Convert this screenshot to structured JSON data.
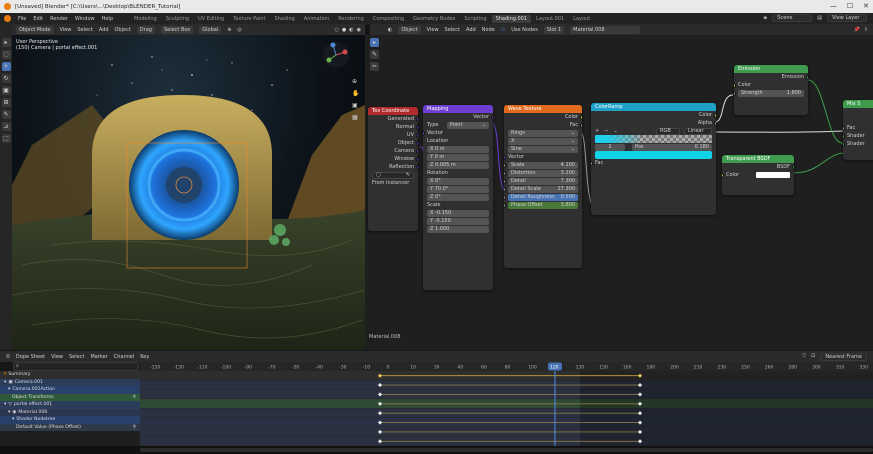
{
  "window": {
    "title": "[Unsaved] Blender* [C:\\Users\\...\\Desktop\\BLENDER_Tutorial]",
    "controls": [
      "—",
      "☐",
      "✕"
    ]
  },
  "menubar": {
    "items": [
      "File",
      "Edit",
      "Render",
      "Window",
      "Help"
    ],
    "workspaces": [
      "Modeling",
      "Sculpting",
      "UV Editing",
      "Texture Paint",
      "Shading",
      "Animation",
      "Rendering",
      "Compositing",
      "Geometry Nodes",
      "Scripting",
      "Shading.001",
      "Layout.001",
      "Layout"
    ],
    "active_workspace": "Shading.001",
    "scene": "Scene",
    "view_layer": "View Layer"
  },
  "viewport": {
    "header": {
      "mode": "Object Mode",
      "items": [
        "View",
        "Select",
        "Add",
        "Object"
      ],
      "drag": "Drag",
      "select": "Select Box",
      "transform": "Global"
    },
    "info_line1": "User Perspective",
    "info_line2": "(150) Camera | portal effect.001",
    "bottom_label": "Material.008",
    "tools": [
      "cursor-tool",
      "select-tool",
      "move-tool",
      "rotate-tool",
      "scale-tool",
      "transform-tool",
      "annotate-tool",
      "measure-tool",
      "add-cube-tool"
    ]
  },
  "node_editor": {
    "header": {
      "type": "Object",
      "items": [
        "View",
        "Select",
        "Add",
        "Node"
      ],
      "use_nodes": "Use Nodes",
      "slot": "Slot 1",
      "material": "Material.008"
    },
    "nodes": {
      "coord": {
        "title": "Tex Coordinate",
        "outputs": [
          "Generated",
          "Normal",
          "UV",
          "Object",
          "Camera",
          "Window",
          "Reflection"
        ],
        "instancer": "From Instancer"
      },
      "mapping": {
        "title": "Mapping",
        "vector_out": "Vector",
        "type_label": "Type",
        "type_value": "Point",
        "vector_in": "Vector",
        "location": "Location",
        "loc": [
          "X  0 m",
          "Y  0 m",
          "Z  0.005 m"
        ],
        "rotation": "Rotation",
        "rot": [
          "X  0°",
          "Y  70.0°",
          "Z  0°"
        ],
        "scale": "Scale",
        "scl": [
          "X  -0.150",
          "Y  -0.150",
          "Z  1.000"
        ]
      },
      "wave": {
        "title": "Wave Texture",
        "color_out": "Color",
        "fac_out": "Fac",
        "drop1": "Rings",
        "drop2": "X",
        "drop3": "Sine",
        "vector_in": "Vector",
        "fields": [
          [
            "Scale",
            "4.100"
          ],
          [
            "Distortion",
            "3.200"
          ],
          [
            "Detail",
            "7.300"
          ],
          [
            "Detail Scale",
            "27.300"
          ],
          [
            "Detail Roughness",
            "0.500"
          ],
          [
            "Phase Offset",
            "3.800"
          ]
        ]
      },
      "ramp": {
        "title": "ColorRamp",
        "color_out": "Color",
        "alpha_out": "Alpha",
        "interp_mode": "RGB",
        "interp": "Linear",
        "stop_index": "1",
        "pos_label": "Pos",
        "pos_value": "0.180",
        "fac_in": "Fac"
      },
      "emission": {
        "title": "Emission",
        "out": "Emission",
        "color": "Color",
        "strength_label": "Strength",
        "strength": "1.800"
      },
      "transparent": {
        "title": "Transparent BSDF",
        "out": "BSDF",
        "color": "Color"
      },
      "mix": {
        "title": "Mix S",
        "inputs": [
          "Fac",
          "Shader",
          "Shader"
        ]
      }
    }
  },
  "dopesheet": {
    "header": {
      "mode": "Dope Sheet",
      "items": [
        "View",
        "Select",
        "Marker",
        "Channel",
        "Key"
      ],
      "snap": "Nearest Frame"
    },
    "ruler": [
      "-150",
      "-130",
      "-110",
      "-100",
      "-90",
      "-70",
      "-50",
      "-40",
      "-30",
      "-10",
      "0",
      "10",
      "30",
      "40",
      "60",
      "80",
      "100",
      "120",
      "130",
      "150",
      "160",
      "180",
      "200",
      "210",
      "230",
      "250",
      "260",
      "280",
      "300",
      "310",
      "330"
    ],
    "current_frame": "120",
    "channels": [
      "Summary",
      "Camera.001",
      "Camera.001Action",
      "Object Transforms",
      "portal effect.001",
      "Material.008",
      "Shader Nodetree",
      "Default Value (Phase Offset)"
    ]
  },
  "colors": {
    "accent": "#4772b3",
    "texture": "#e26a1c",
    "vector": "#6c3fd1",
    "converter": "#1fa0c9",
    "shader": "#3f9c4d",
    "input": "#b02c2c"
  }
}
